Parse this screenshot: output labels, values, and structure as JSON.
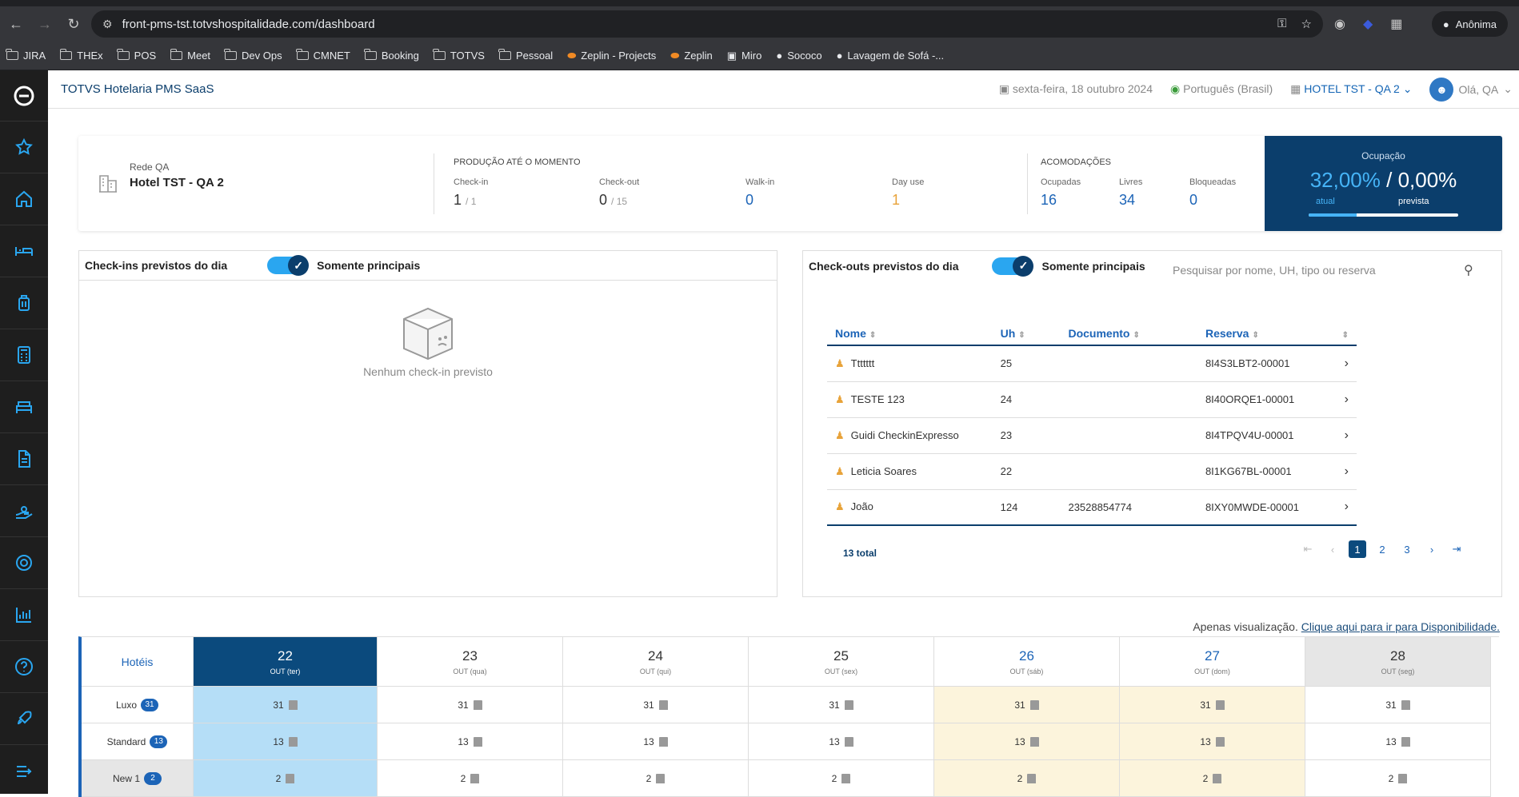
{
  "browser": {
    "url": "front-pms-tst.totvshospitalidade.com/dashboard",
    "profile": "Anônima",
    "bookmarks": [
      "JIRA",
      "THEx",
      "POS",
      "Meet",
      "Dev Ops",
      "CMNET",
      "Booking",
      "TOTVS",
      "Pessoal",
      "Zeplin - Projects",
      "Zeplin",
      "Miro",
      "Sococo",
      "Lavagem de Sofá -..."
    ]
  },
  "header": {
    "title": "TOTVS Hotelaria PMS SaaS",
    "date": "sexta-feira, 18 outubro 2024",
    "language": "Português (Brasil)",
    "hotel": "HOTEL TST - QA 2",
    "greeting": "Olá, QA"
  },
  "summary": {
    "network": "Rede QA",
    "hotel_name": "Hotel TST - QA 2",
    "production_title": "PRODUÇÃO ATÉ O MOMENTO",
    "checkin_label": "Check-in",
    "checkin_value": "1",
    "checkin_total": "/ 1",
    "checkout_label": "Check-out",
    "checkout_value": "0",
    "checkout_total": "/ 15",
    "walkin_label": "Walk-in",
    "walkin_value": "0",
    "dayuse_label": "Day use",
    "dayuse_value": "1",
    "accommodations_title": "ACOMODAÇÕES",
    "occupied_label": "Ocupadas",
    "occupied_value": "16",
    "free_label": "Livres",
    "free_value": "34",
    "blocked_label": "Bloqueadas",
    "blocked_value": "0",
    "occupancy_title": "Ocupação",
    "occupancy_current": "32,00%",
    "occupancy_forecast": "0,00%",
    "current_label": "atual",
    "forecast_label": "prevista",
    "occupancy_fraction": 0.32
  },
  "checkins": {
    "title": "Check-ins previstos do dia",
    "toggle_label": "Somente principais",
    "empty": "Nenhum check-in previsto"
  },
  "checkouts": {
    "title": "Check-outs previstos do dia",
    "toggle_label": "Somente principais",
    "search_placeholder": "Pesquisar por nome, UH, tipo ou reserva",
    "columns": [
      "Nome",
      "Uh",
      "Documento",
      "Reserva"
    ],
    "rows": [
      {
        "name": "Ttttttt",
        "uh": "25",
        "doc": "",
        "res": "8I4S3LBT2-00001"
      },
      {
        "name": "TESTE 123",
        "uh": "24",
        "doc": "",
        "res": "8I40ORQE1-00001"
      },
      {
        "name": "Guidi CheckinExpresso",
        "uh": "23",
        "doc": "",
        "res": "8I4TPQV4U-00001"
      },
      {
        "name": "Leticia Soares",
        "uh": "22",
        "doc": "",
        "res": "8I1KG67BL-00001"
      },
      {
        "name": "João",
        "uh": "124",
        "doc": "23528854774",
        "res": "8IXY0MWDE-00001"
      }
    ],
    "total": "13 total",
    "pages": [
      "1",
      "2",
      "3"
    ]
  },
  "availability": {
    "note": "Apenas visualização.",
    "link": "Clique aqui para ir para Disponibilidade.",
    "hotels_label": "Hotéis",
    "days": [
      {
        "d": "22",
        "m": "OUT (ter)"
      },
      {
        "d": "23",
        "m": "OUT (qua)"
      },
      {
        "d": "24",
        "m": "OUT (qui)"
      },
      {
        "d": "25",
        "m": "OUT (sex)"
      },
      {
        "d": "26",
        "m": "OUT (sáb)"
      },
      {
        "d": "27",
        "m": "OUT (dom)"
      },
      {
        "d": "28",
        "m": "OUT (seg)"
      }
    ],
    "rooms": [
      {
        "name": "Luxo",
        "count": "31",
        "values": [
          "31",
          "31",
          "31",
          "31",
          "31",
          "31",
          "31"
        ]
      },
      {
        "name": "Standard",
        "count": "13",
        "values": [
          "13",
          "13",
          "13",
          "13",
          "13",
          "13",
          "13"
        ]
      },
      {
        "name": "New 1",
        "count": "2",
        "values": [
          "2",
          "2",
          "2",
          "2",
          "2",
          "2",
          "2"
        ]
      }
    ]
  }
}
